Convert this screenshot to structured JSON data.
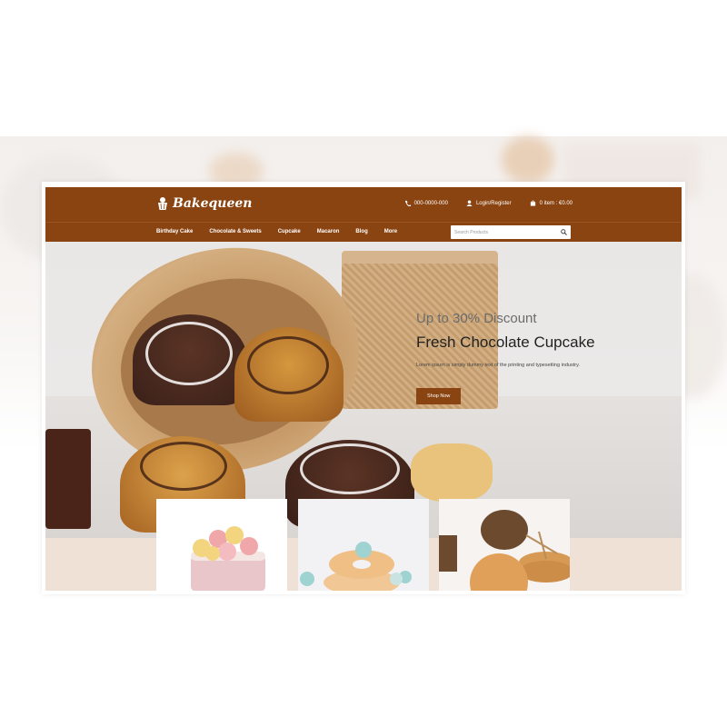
{
  "brand": {
    "name": "Bakequeen"
  },
  "header": {
    "phone": "000-0000-000",
    "login": "Login/Register",
    "cart": "0 item : €0.00"
  },
  "nav": {
    "items": [
      "Birthday Cake",
      "Chocolate & Sweets",
      "Cupcake",
      "Macaron",
      "Blog",
      "More"
    ]
  },
  "search": {
    "placeholder": "Search Products"
  },
  "hero": {
    "subtitle": "Up to 30% Discount",
    "title": "Fresh Chocolate Cupcake",
    "description": "Lorem ipsum is simply dummy text of the printing and typesetting industry.",
    "button": "Shop Now"
  },
  "icons": [
    "cupcake-logo-icon",
    "phone-icon",
    "user-icon",
    "cart-icon",
    "search-icon"
  ],
  "colors": {
    "brand": "#8a4411",
    "button": "#8a4411",
    "band": "#efe1d6"
  }
}
